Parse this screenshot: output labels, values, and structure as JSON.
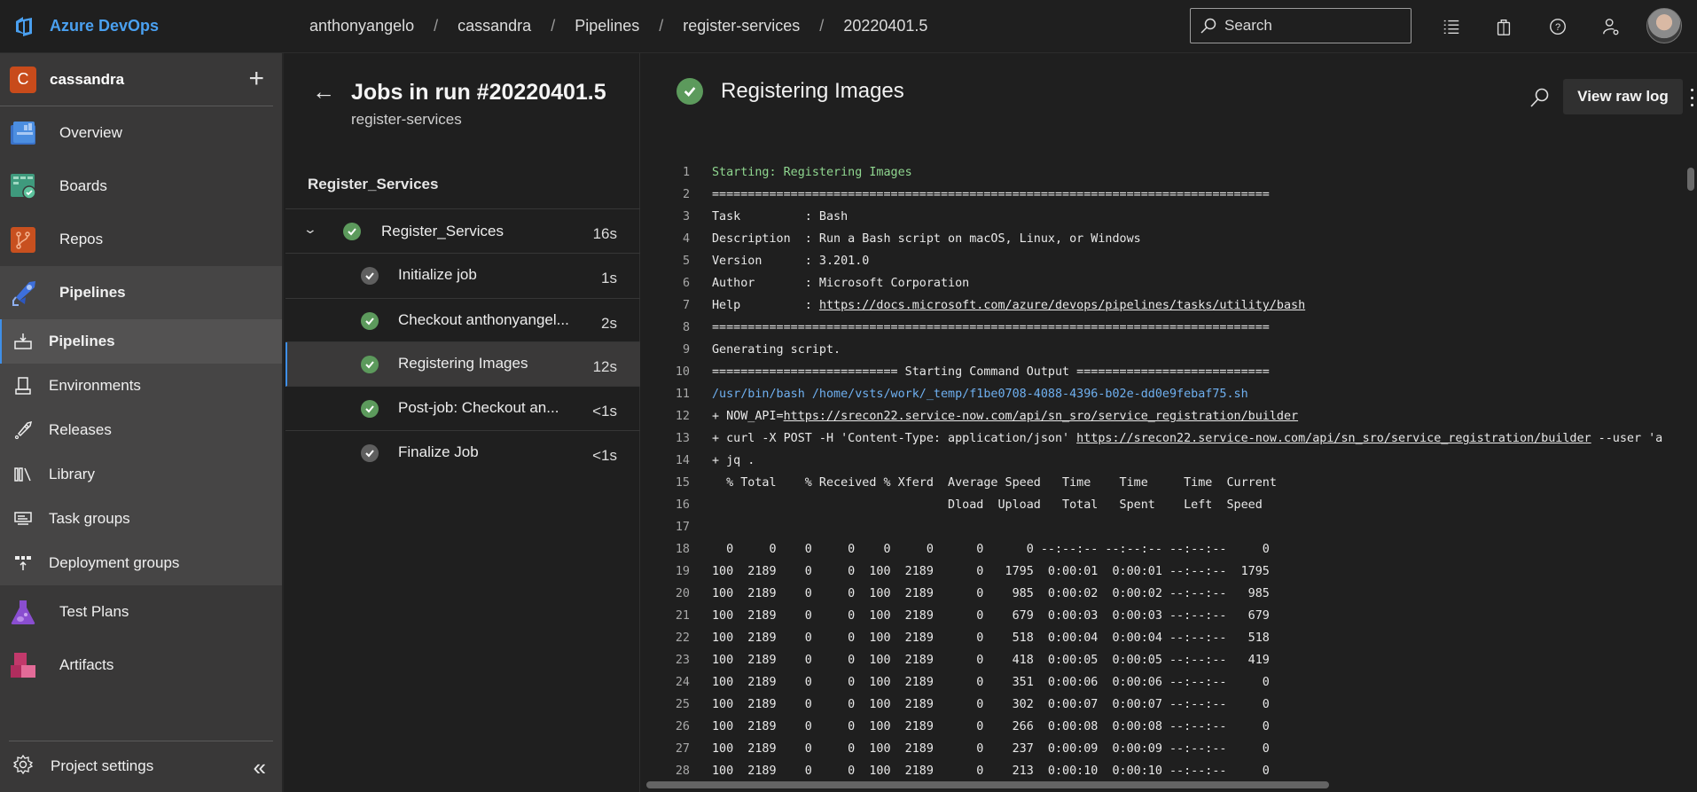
{
  "app": {
    "name": "Azure DevOps",
    "brand_color": "#4aa0f0"
  },
  "breadcrumb": [
    "anthonyangelo",
    "cassandra",
    "Pipelines",
    "register-services",
    "20220401.5"
  ],
  "topbar": {
    "search_placeholder": "Search",
    "icons": [
      "task-list-icon",
      "marketplace-bag-icon",
      "help-icon",
      "user-settings-icon"
    ]
  },
  "sidebar": {
    "project": {
      "initial": "C",
      "name": "cassandra",
      "badge_color": "#c84b1b"
    },
    "items": [
      {
        "label": "Overview",
        "icon": "overview-icon"
      },
      {
        "label": "Boards",
        "icon": "boards-icon"
      },
      {
        "label": "Repos",
        "icon": "repos-icon"
      },
      {
        "label": "Pipelines",
        "icon": "pipelines-icon"
      }
    ],
    "pipelines_sub": [
      {
        "label": "Pipelines",
        "icon": "pipelines-sub-icon",
        "selected": true
      },
      {
        "label": "Environments",
        "icon": "environments-icon"
      },
      {
        "label": "Releases",
        "icon": "releases-icon"
      },
      {
        "label": "Library",
        "icon": "library-icon"
      },
      {
        "label": "Task groups",
        "icon": "task-groups-icon"
      },
      {
        "label": "Deployment groups",
        "icon": "deployment-groups-icon"
      }
    ],
    "items_after": [
      {
        "label": "Test Plans",
        "icon": "test-plans-icon"
      },
      {
        "label": "Artifacts",
        "icon": "artifacts-icon"
      }
    ],
    "settings_label": "Project settings"
  },
  "jobs_panel": {
    "title": "Jobs in run #20220401.5",
    "subtitle": "register-services",
    "stage": "Register_Services",
    "job": {
      "name": "Register_Services",
      "duration": "16s",
      "status": "succeeded"
    },
    "steps": [
      {
        "name": "Initialize job",
        "duration": "1s",
        "status": "skipped"
      },
      {
        "name": "Checkout anthonyangel...",
        "duration": "2s",
        "status": "succeeded"
      },
      {
        "name": "Registering Images",
        "duration": "12s",
        "status": "succeeded",
        "selected": true
      },
      {
        "name": "Post-job: Checkout an...",
        "duration": "<1s",
        "status": "succeeded"
      },
      {
        "name": "Finalize Job",
        "duration": "<1s",
        "status": "skipped"
      }
    ]
  },
  "log_panel": {
    "title": "Registering Images",
    "view_raw_label": "View raw log",
    "lines": [
      {
        "n": "1",
        "text": "Starting: Registering Images",
        "style": "green"
      },
      {
        "n": "2",
        "text": "=============================================================================="
      },
      {
        "n": "3",
        "text": "Task         : Bash"
      },
      {
        "n": "4",
        "text": "Description  : Run a Bash script on macOS, Linux, or Windows"
      },
      {
        "n": "5",
        "text": "Version      : 3.201.0"
      },
      {
        "n": "6",
        "text": "Author       : Microsoft Corporation"
      },
      {
        "n": "7",
        "prefix": "Help         : ",
        "link": "https://docs.microsoft.com/azure/devops/pipelines/tasks/utility/bash"
      },
      {
        "n": "8",
        "text": "=============================================================================="
      },
      {
        "n": "9",
        "text": "Generating script."
      },
      {
        "n": "10",
        "text": "========================== Starting Command Output ==========================="
      },
      {
        "n": "11",
        "text": "/usr/bin/bash /home/vsts/work/_temp/f1be0708-4088-4396-b02e-dd0e9febaf75.sh",
        "style": "blue"
      },
      {
        "n": "12",
        "prefix": "+ NOW_API=",
        "link": "https://srecon22.service-now.com/api/sn_sro/service_registration/builder"
      },
      {
        "n": "13",
        "prefix": "+ curl -X POST -H 'Content-Type: application/json' ",
        "link": "https://srecon22.service-now.com/api/sn_sro/service_registration/builder",
        "suffix": " --user 'a"
      },
      {
        "n": "14",
        "text": "+ jq ."
      },
      {
        "n": "15",
        "text": "  % Total    % Received % Xferd  Average Speed   Time    Time     Time  Current"
      },
      {
        "n": "16",
        "text": "                                 Dload  Upload   Total   Spent    Left  Speed"
      },
      {
        "n": "17",
        "text": ""
      },
      {
        "n": "18",
        "text": "  0     0    0     0    0     0      0      0 --:--:-- --:--:-- --:--:--     0"
      },
      {
        "n": "19",
        "text": "100  2189    0     0  100  2189      0   1795  0:00:01  0:00:01 --:--:--  1795"
      },
      {
        "n": "20",
        "text": "100  2189    0     0  100  2189      0    985  0:00:02  0:00:02 --:--:--   985"
      },
      {
        "n": "21",
        "text": "100  2189    0     0  100  2189      0    679  0:00:03  0:00:03 --:--:--   679"
      },
      {
        "n": "22",
        "text": "100  2189    0     0  100  2189      0    518  0:00:04  0:00:04 --:--:--   518"
      },
      {
        "n": "23",
        "text": "100  2189    0     0  100  2189      0    418  0:00:05  0:00:05 --:--:--   419"
      },
      {
        "n": "24",
        "text": "100  2189    0     0  100  2189      0    351  0:00:06  0:00:06 --:--:--     0"
      },
      {
        "n": "25",
        "text": "100  2189    0     0  100  2189      0    302  0:00:07  0:00:07 --:--:--     0"
      },
      {
        "n": "26",
        "text": "100  2189    0     0  100  2189      0    266  0:00:08  0:00:08 --:--:--     0"
      },
      {
        "n": "27",
        "text": "100  2189    0     0  100  2189      0    237  0:00:09  0:00:09 --:--:--     0"
      },
      {
        "n": "28",
        "text": "100  2189    0     0  100  2189      0    213  0:00:10  0:00:10 --:--:--     0"
      }
    ]
  },
  "colors": {
    "success": "#5c9a5c",
    "skipped": "#5f5f5f",
    "selection_accent": "#3f8fe8",
    "log_green": "#8fd68f",
    "log_blue": "#6fb0f0"
  }
}
